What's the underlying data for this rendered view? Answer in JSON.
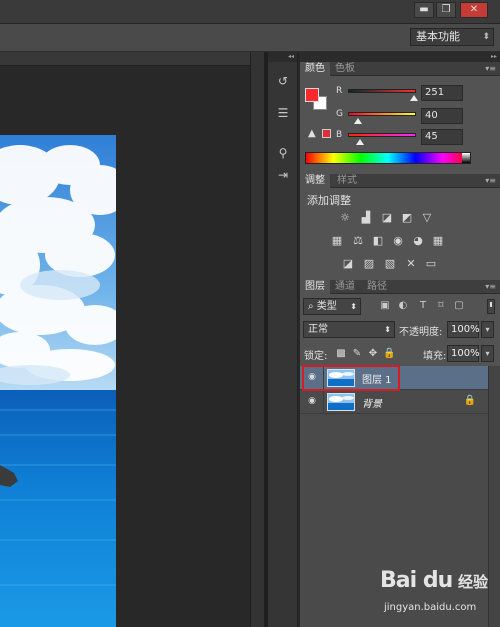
{
  "window": {
    "minimize_icon": "minimize-icon",
    "restore_icon": "restore-icon",
    "close_icon": "close-icon",
    "minimize_glyph": "▬",
    "restore_glyph": "❐",
    "close_glyph": "✕"
  },
  "options_bar": {
    "workspace_value": "基本功能",
    "workspace_arrow": "⬍"
  },
  "dock": {
    "collapse_glyph": "◂◂",
    "icons": [
      "history-icon",
      "properties-icon",
      "brush-presets-icon",
      "tool-presets-icon"
    ],
    "glyphs": [
      "↺",
      "☰",
      "⚲",
      "⇥"
    ]
  },
  "panels": {
    "collapse_glyph": "▸▸",
    "menu_glyph": "▾≡",
    "color": {
      "tabs": [
        "颜色",
        "色板"
      ],
      "foreground_color": "#fb282d",
      "background_color": "#ffffff",
      "warning_glyph": "▲",
      "channels": [
        {
          "label": "R",
          "value": "251"
        },
        {
          "label": "G",
          "value": "40"
        },
        {
          "label": "B",
          "value": "45"
        }
      ]
    },
    "adjustments": {
      "tabs": [
        "调整",
        "样式"
      ],
      "title": "添加调整",
      "row1_icons": [
        "brightness-icon",
        "levels-icon",
        "curves-icon",
        "exposure-icon",
        "vibrance-icon"
      ],
      "row1_glyphs": [
        "☼",
        "▟",
        "◪",
        "◩",
        "▽"
      ],
      "row2_icons": [
        "hue-saturation-icon",
        "color-balance-icon",
        "black-white-icon",
        "photo-filter-icon",
        "channel-mixer-icon",
        "color-lookup-icon"
      ],
      "row2_glyphs": [
        "▦",
        "⚖",
        "◧",
        "◉",
        "◕",
        "▦"
      ],
      "row3_icons": [
        "invert-icon",
        "posterize-icon",
        "threshold-icon",
        "selective-color-icon",
        "gradient-map-icon"
      ],
      "row3_glyphs": [
        "◪",
        "▨",
        "▧",
        "✕",
        "▭"
      ]
    },
    "layers": {
      "tabs": [
        "图层",
        "通道",
        "路径"
      ],
      "filter_label": "类型",
      "filter_glyph": "⌕",
      "filter_arrow": "⬍",
      "filter_icons": [
        "pixel-filter-icon",
        "adjustment-filter-icon",
        "type-filter-icon",
        "shape-filter-icon",
        "smart-object-filter-icon"
      ],
      "filter_glyphs": [
        "▣",
        "◐",
        "T",
        "⌑",
        "▢"
      ],
      "blend_mode": "正常",
      "blend_arrow": "⬍",
      "opacity_label": "不透明度:",
      "opacity_value": "100%",
      "lock_label": "锁定:",
      "lock_icons": [
        "lock-transparent-icon",
        "lock-pixels-icon",
        "lock-position-icon",
        "lock-all-icon"
      ],
      "lock_glyphs": [
        "▩",
        "✎",
        "✥",
        "🔒"
      ],
      "fill_label": "填充:",
      "fill_value": "100%",
      "dropdown_glyph": "▾",
      "eye_glyph": "◉",
      "items": [
        {
          "name": "图层 1",
          "selected": true,
          "locked": false
        },
        {
          "name": "背景",
          "selected": false,
          "locked": true,
          "lock_glyph": "🔒"
        }
      ]
    }
  },
  "watermark": {
    "logo": "Bai du",
    "brand": "经验",
    "url": "jingyan.baidu.com"
  }
}
